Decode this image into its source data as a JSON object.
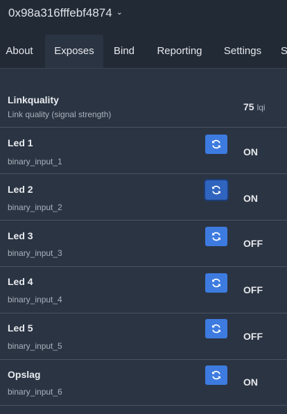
{
  "header": {
    "device_id": "0x98a316fffebf4874",
    "chevron_icon": "chevron-down-icon"
  },
  "tabs": [
    {
      "label": "About"
    },
    {
      "label": "Exposes",
      "active": true
    },
    {
      "label": "Bind"
    },
    {
      "label": "Reporting"
    },
    {
      "label": "Settings"
    },
    {
      "label": "S"
    }
  ],
  "linkquality": {
    "title": "Linkquality",
    "description": "Link quality (signal strength)",
    "value": "75",
    "unit": "lqi"
  },
  "exposes": [
    {
      "title": "Led 1",
      "property": "binary_input_1",
      "state": "ON",
      "refresh_icon": "refresh-icon"
    },
    {
      "title": "Led 2",
      "property": "binary_input_2",
      "state": "ON",
      "refresh_icon": "refresh-icon",
      "focused": true
    },
    {
      "title": "Led 3",
      "property": "binary_input_3",
      "state": "OFF",
      "refresh_icon": "refresh-icon"
    },
    {
      "title": "Led 4",
      "property": "binary_input_4",
      "state": "OFF",
      "refresh_icon": "refresh-icon"
    },
    {
      "title": "Led 5",
      "property": "binary_input_5",
      "state": "OFF",
      "refresh_icon": "refresh-icon"
    },
    {
      "title": "Opslag",
      "property": "binary_input_6",
      "state": "ON",
      "refresh_icon": "refresh-icon"
    }
  ],
  "colors": {
    "background": "#2b3443",
    "header": "#222a36",
    "accent": "#3d7be0"
  }
}
